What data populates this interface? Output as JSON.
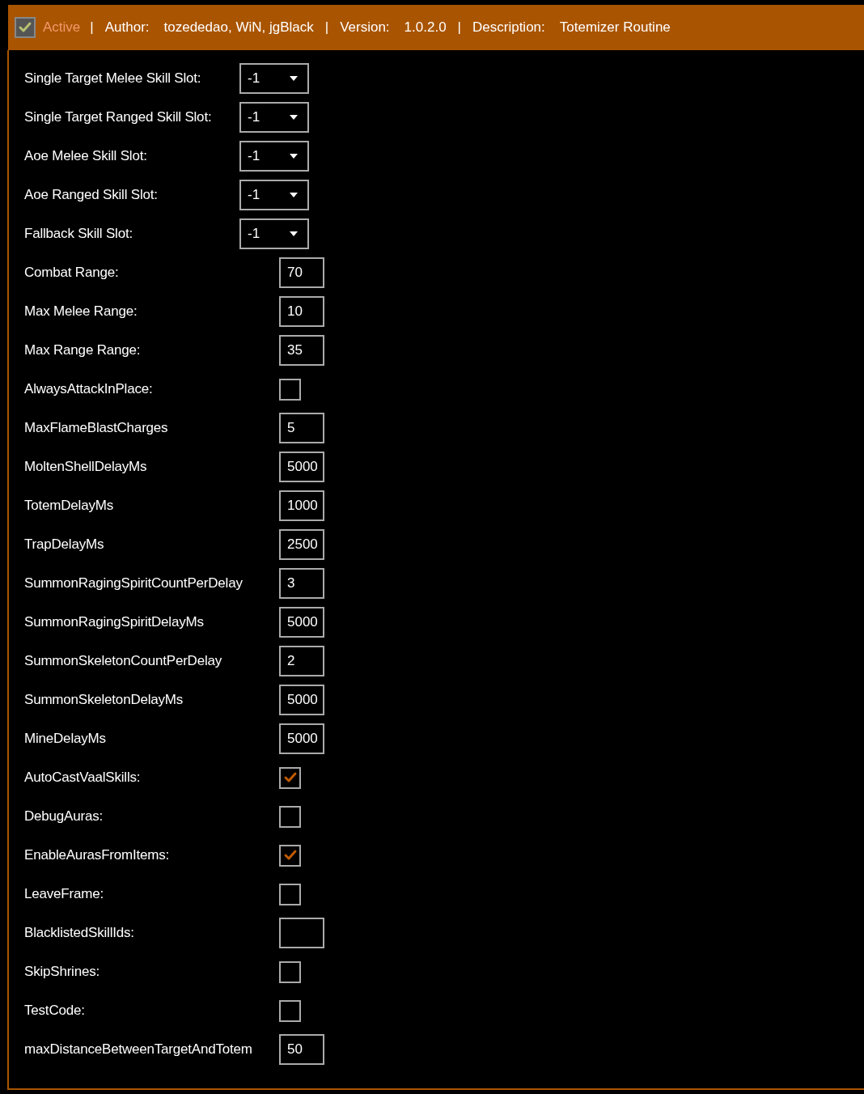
{
  "header": {
    "active": {
      "label": "Active",
      "checked": true
    },
    "separator_1": "|",
    "author_label": "Author:",
    "author": "tozededao, WiN, jgBlack",
    "separator_2": "|",
    "version_label": "Version:",
    "version": "1.0.2.0",
    "separator_3": "|",
    "description_label": "Description:",
    "description": "Totemizer Routine"
  },
  "settings": [
    {
      "kind": "dropdown",
      "label": "Single Target Melee Skill Slot:",
      "value": "-1"
    },
    {
      "kind": "dropdown",
      "label": "Single Target Ranged Skill Slot:",
      "value": "-1"
    },
    {
      "kind": "dropdown",
      "label": "Aoe Melee Skill Slot:",
      "value": "-1"
    },
    {
      "kind": "dropdown",
      "label": "Aoe Ranged Skill Slot:",
      "value": "-1"
    },
    {
      "kind": "dropdown",
      "label": "Fallback Skill Slot:",
      "value": "-1"
    },
    {
      "kind": "text",
      "label": "Combat Range:",
      "value": "70"
    },
    {
      "kind": "text",
      "label": "Max Melee Range:",
      "value": "10"
    },
    {
      "kind": "text",
      "label": "Max Range Range:",
      "value": "35"
    },
    {
      "kind": "checkbox",
      "label": "AlwaysAttackInPlace:",
      "checked": false
    },
    {
      "kind": "text",
      "label": "MaxFlameBlastCharges",
      "value": "5"
    },
    {
      "kind": "text",
      "label": "MoltenShellDelayMs",
      "value": "5000"
    },
    {
      "kind": "text",
      "label": "TotemDelayMs",
      "value": "1000"
    },
    {
      "kind": "text",
      "label": "TrapDelayMs",
      "value": "2500"
    },
    {
      "kind": "text",
      "label": "SummonRagingSpiritCountPerDelay",
      "value": "3"
    },
    {
      "kind": "text",
      "label": "SummonRagingSpiritDelayMs",
      "value": "5000"
    },
    {
      "kind": "text",
      "label": "SummonSkeletonCountPerDelay",
      "value": "2"
    },
    {
      "kind": "text",
      "label": "SummonSkeletonDelayMs",
      "value": "5000"
    },
    {
      "kind": "text",
      "label": "MineDelayMs",
      "value": "5000"
    },
    {
      "kind": "checkbox",
      "label": "AutoCastVaalSkills:",
      "checked": true
    },
    {
      "kind": "checkbox",
      "label": "DebugAuras:",
      "checked": false
    },
    {
      "kind": "checkbox",
      "label": "EnableAurasFromItems:",
      "checked": true
    },
    {
      "kind": "checkbox",
      "label": "LeaveFrame:",
      "checked": false
    },
    {
      "kind": "text",
      "label": "BlacklistedSkillIds:"
    },
    {
      "kind": "checkbox",
      "label": "SkipShrines:",
      "checked": false
    },
    {
      "kind": "checkbox",
      "label": "TestCode:",
      "checked": false
    },
    {
      "kind": "text",
      "label": "maxDistanceBetweenTargetAndTotem",
      "value": "50"
    }
  ]
}
